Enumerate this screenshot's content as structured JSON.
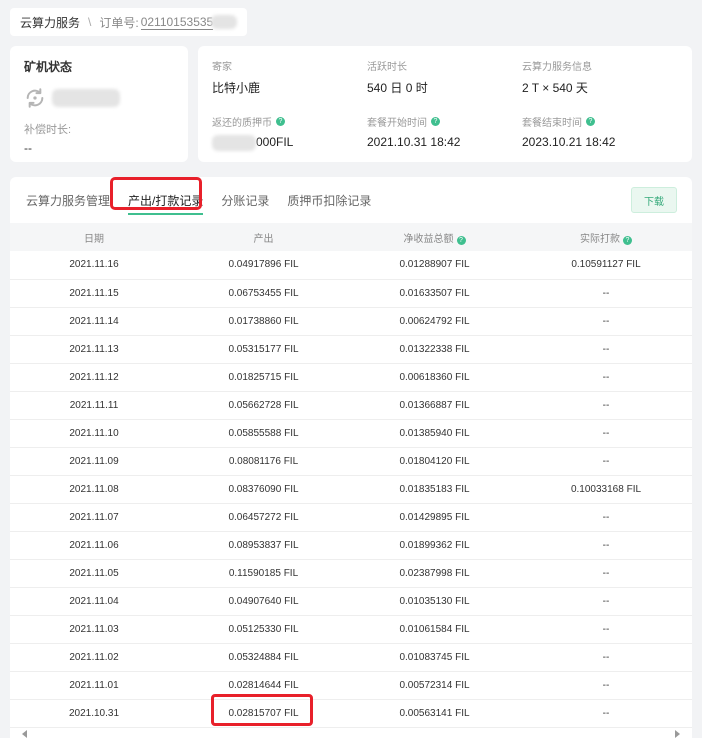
{
  "breadcrumb": {
    "home": "云算力服务",
    "separator": "\\",
    "order_label": "订单号:",
    "order_no": "02110153535"
  },
  "machine": {
    "title": "矿机状态",
    "comp_label": "补偿时长:",
    "comp_value": "--"
  },
  "info": {
    "items": [
      {
        "label": "寄家",
        "value": "比特小鹿",
        "help": false
      },
      {
        "label": "活跃时长",
        "value": "540 日 0 时",
        "help": false
      },
      {
        "label": "云算力服务信息",
        "value": "2 T × 540 天",
        "help": false
      },
      {
        "label": "返还的质押币",
        "value": "000FIL",
        "help": true
      },
      {
        "label": "套餐开始时间",
        "value": "2021.10.31 18:42",
        "help": true
      },
      {
        "label": "套餐结束时间",
        "value": "2023.10.21 18:42",
        "help": true
      }
    ]
  },
  "tabs": [
    "云算力服务管理",
    "产出/打款记录",
    "分账记录",
    "质押币扣除记录"
  ],
  "active_tab": 1,
  "download_label": "下载",
  "table": {
    "headers": [
      "日期",
      "产出",
      "净收益总额",
      "实际打款"
    ],
    "rows": [
      [
        "2021.11.16",
        "0.04917896 FIL",
        "0.01288907 FIL",
        "0.10591127 FIL"
      ],
      [
        "2021.11.15",
        "0.06753455 FIL",
        "0.01633507 FIL",
        "--"
      ],
      [
        "2021.11.14",
        "0.01738860 FIL",
        "0.00624792 FIL",
        "--"
      ],
      [
        "2021.11.13",
        "0.05315177 FIL",
        "0.01322338 FIL",
        "--"
      ],
      [
        "2021.11.12",
        "0.01825715 FIL",
        "0.00618360 FIL",
        "--"
      ],
      [
        "2021.11.11",
        "0.05662728 FIL",
        "0.01366887 FIL",
        "--"
      ],
      [
        "2021.11.10",
        "0.05855588 FIL",
        "0.01385940 FIL",
        "--"
      ],
      [
        "2021.11.09",
        "0.08081176 FIL",
        "0.01804120 FIL",
        "--"
      ],
      [
        "2021.11.08",
        "0.08376090 FIL",
        "0.01835183 FIL",
        "0.10033168 FIL"
      ],
      [
        "2021.11.07",
        "0.06457272 FIL",
        "0.01429895 FIL",
        "--"
      ],
      [
        "2021.11.06",
        "0.08953837 FIL",
        "0.01899362 FIL",
        "--"
      ],
      [
        "2021.11.05",
        "0.11590185 FIL",
        "0.02387998 FIL",
        "--"
      ],
      [
        "2021.11.04",
        "0.04907640 FIL",
        "0.01035130 FIL",
        "--"
      ],
      [
        "2021.11.03",
        "0.05125330 FIL",
        "0.01061584 FIL",
        "--"
      ],
      [
        "2021.11.02",
        "0.05324884 FIL",
        "0.01083745 FIL",
        "--"
      ],
      [
        "2021.11.01",
        "0.02814644 FIL",
        "0.00572314 FIL",
        "--"
      ],
      [
        "2021.10.31",
        "0.02815707 FIL",
        "0.00563141 FIL",
        "--"
      ]
    ]
  },
  "colors": {
    "accent": "#3fbf8f",
    "highlight": "#e8202a"
  }
}
